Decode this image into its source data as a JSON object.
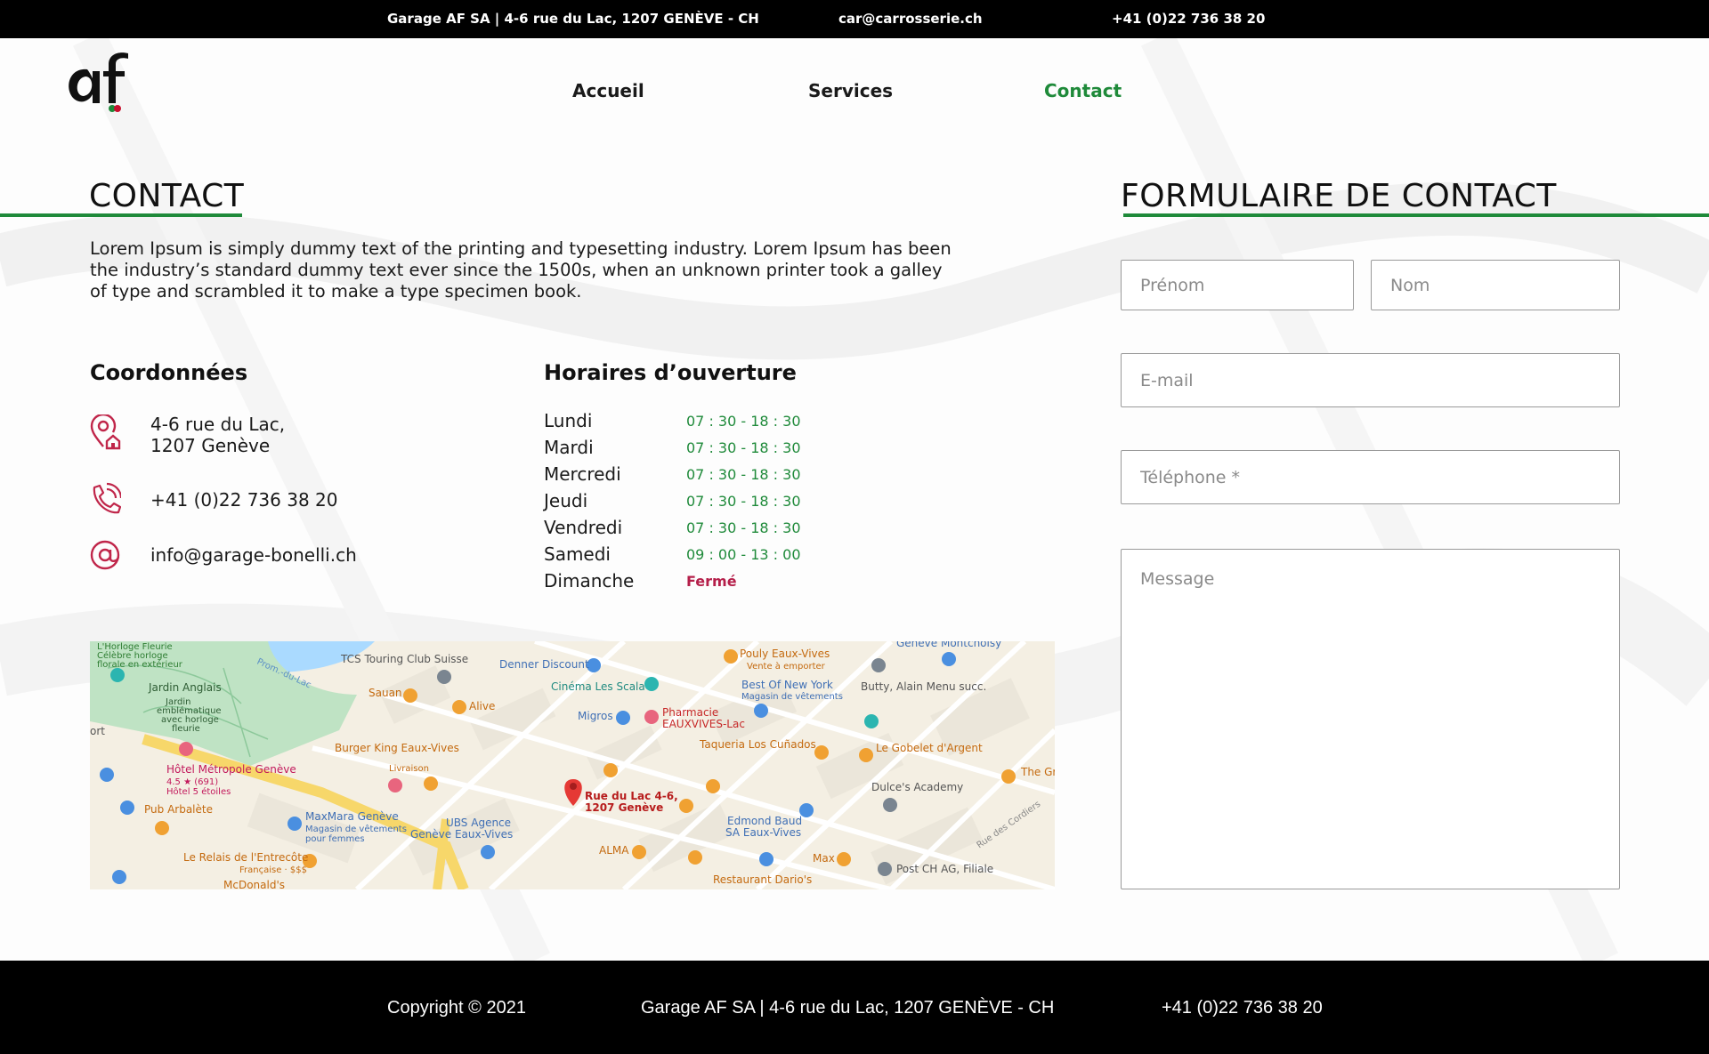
{
  "topbar": {
    "address": "Garage AF SA | 4-6 rue du Lac, 1207 GENÈVE - CH",
    "email": "car@carrosserie.ch",
    "phone": "+41 (0)22 736 38 20"
  },
  "logo": {
    "text": "af",
    "icon": "af-logo"
  },
  "nav": {
    "items": [
      "Accueil",
      "Services",
      "Contact"
    ],
    "active": "Contact",
    "active_color": "#1f8a3a"
  },
  "contact": {
    "title": "CONTACT",
    "intro": "Lorem Ipsum is simply dummy text of the printing and typesetting industry. Lorem Ipsum has been the industry’s standard dummy text ever since the 1500s, when an unknown printer took a galley of type and scrambled it to make a type specimen book.",
    "coords": {
      "title": "Coordonnées",
      "address_line1": "4-6 rue du Lac,",
      "address_line2": "1207 Genève",
      "phone": "+41 (0)22 736 38 20",
      "email": "info@garage-bonelli.ch",
      "icons": [
        "map-pin-home-icon",
        "phone-icon",
        "at-sign-icon"
      ]
    },
    "hours": {
      "title": "Horaires d’ouverture",
      "rows": [
        {
          "day": "Lundi",
          "time": "07 : 30 - 18 : 30"
        },
        {
          "day": "Mardi",
          "time": "07 : 30 - 18 : 30"
        },
        {
          "day": "Mercredi",
          "time": "07 : 30 - 18 : 30"
        },
        {
          "day": "Jeudi",
          "time": "07 : 30 - 18 : 30"
        },
        {
          "day": "Vendredi",
          "time": "07 : 30 - 18 : 30"
        },
        {
          "day": "Samedi",
          "time": "09 : 00 - 13 : 00"
        },
        {
          "day": "Dimanche",
          "time": "Fermé"
        }
      ]
    },
    "map": {
      "marker": "Rue du Lac 4-6,\n1207 Genève",
      "labels": [
        "L'Horloge Fleurie",
        "Célèbre horloge",
        "florale en extérieur",
        "Jardin Anglais",
        "Jardin",
        "emblématique",
        "avec horloge",
        "fleurie",
        "TCS Touring Club Suisse",
        "Denner Discount",
        "Pouly Eaux-Vives",
        "Vente à emporter",
        "Genève Montchoisy",
        "Cinéma Les Scala",
        "Best Of New York",
        "Magasin de vêtements",
        "Butty, Alain Menu succ.",
        "Sauan",
        "Alive",
        "Migros",
        "Pharmacie",
        "EAUXVIVES-Lac",
        "Burger King Eaux-Vives",
        "Livraison",
        "Taqueria Los Cuñados",
        "Le Gobelet d'Argent",
        "Hôtel Métropole Genève",
        "4.5 ★ (691)",
        "Hôtel 5 étoiles",
        "Dulce's Academy",
        "The Gr",
        "Pub Arbalète",
        "MaxMara Genève",
        "Magasin de vêtements",
        "pour femmes",
        "UBS Agence",
        "Genève Eaux-Vives",
        "Edmond Baud",
        "SA Eaux-Vives",
        "Le Relais de l'Entrecôte",
        "Française · $$$",
        "ALMA",
        "Max",
        "Post CH AG, Filiale",
        "McDonald's",
        "Restaurant Dario's",
        "Rue des Cordiers",
        "Prom.-du-Lac",
        "ort"
      ]
    }
  },
  "form": {
    "title": "FORMULAIRE DE CONTACT",
    "firstname_placeholder": "Prénom",
    "lastname_placeholder": "Nom",
    "email_placeholder": "E-mail",
    "phone_placeholder": "Téléphone *",
    "message_placeholder": "Message"
  },
  "footer": {
    "copyright": "Copyright © 2021",
    "address": "Garage AF SA | 4-6 rue du Lac, 1207 GENÈVE - CH",
    "phone": "+41 (0)22 736 38 20"
  }
}
